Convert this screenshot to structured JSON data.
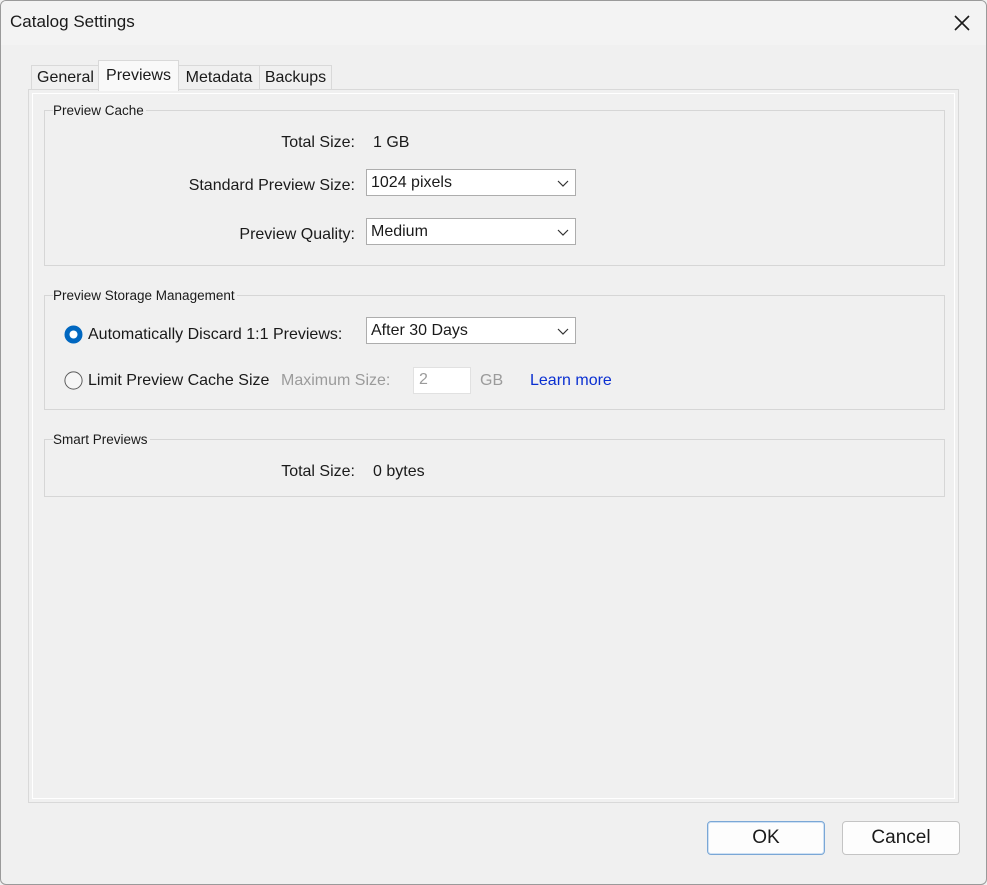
{
  "window": {
    "title": "Catalog Settings"
  },
  "tabs": [
    {
      "label": "General"
    },
    {
      "label": "Previews",
      "active": true
    },
    {
      "label": "Metadata"
    },
    {
      "label": "Backups"
    }
  ],
  "preview_cache": {
    "legend": "Preview Cache",
    "total_size_label": "Total Size:",
    "total_size_value": "1 GB",
    "standard_size_label": "Standard Preview Size:",
    "standard_size_value": "1024 pixels",
    "quality_label": "Preview Quality:",
    "quality_value": "Medium"
  },
  "storage": {
    "legend": "Preview Storage Management",
    "auto_discard_label": "Automatically Discard 1:1 Previews:",
    "auto_discard_value": "After 30 Days",
    "auto_discard_selected": true,
    "limit_label": "Limit Preview Cache Size",
    "limit_selected": false,
    "max_size_label": "Maximum Size:",
    "max_size_value": "2",
    "max_size_unit": "GB",
    "learn_more": "Learn more"
  },
  "smart_previews": {
    "legend": "Smart Previews",
    "total_size_label": "Total Size:",
    "total_size_value": "0 bytes"
  },
  "buttons": {
    "ok": "OK",
    "cancel": "Cancel"
  },
  "colors": {
    "accent": "#0067c0",
    "link": "#0a2fd1",
    "disabled": "#9b9b9b"
  },
  "icons": {
    "close": "close-icon",
    "dropdown": "chevron-down-icon"
  }
}
